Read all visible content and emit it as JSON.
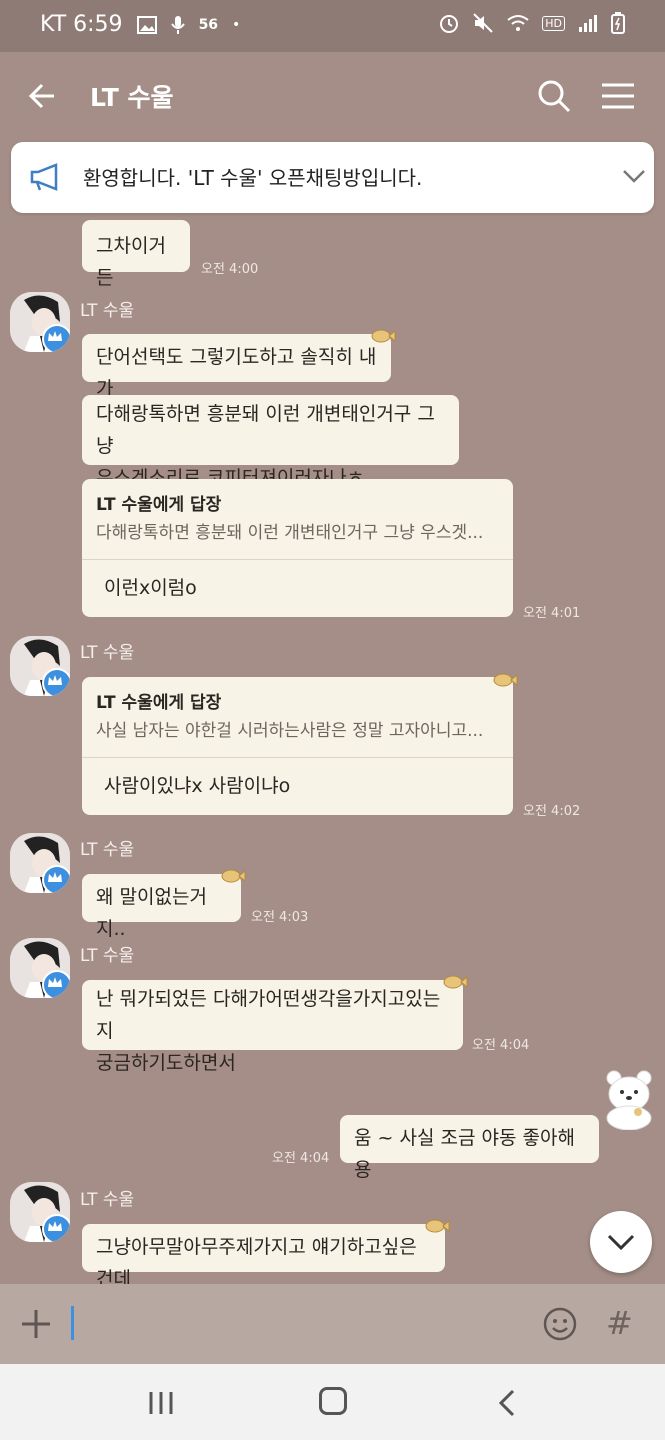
{
  "status": {
    "carrier_time": "KT 6:59",
    "net": "56",
    "dot": "•",
    "hd": "HD",
    "icons": [
      "image-icon",
      "mic-icon",
      "alarm-icon",
      "mute-icon",
      "wifi-icon",
      "signal-icon",
      "battery-icon"
    ]
  },
  "header": {
    "title": "LT 수울"
  },
  "notice": {
    "text": "환영합니다. 'LT 수울' 오픈채팅방입니다."
  },
  "messages": [
    {
      "text": "그차이거든",
      "time": "오전 4:00"
    },
    {
      "sender": "LT 수울",
      "text": "단어선택도 그렇기도하고 솔직히 내가"
    },
    {
      "text_line1": "다해랑톡하면 흥분돼 이런 개변태인거구 그냥",
      "text_line2": "우스겟소리로 코피터져이러자나ㅎ"
    },
    {
      "reply_head": "LT 수울에게 답장",
      "reply_quote": "다해랑톡하면 흥분돼 이런 개변태인거구 그냥 우스겟...",
      "reply_body": "이런x이럼o",
      "time": "오전 4:01"
    },
    {
      "sender": "LT 수울",
      "reply_head": "LT 수울에게 답장",
      "reply_quote": "사실 남자는 야한걸 시러하는사람은 정말 고자아니고...",
      "reply_body": "사람이있냐x 사람이냐o",
      "time": "오전 4:02"
    },
    {
      "sender": "LT 수울",
      "text": "왜 말이없는거지..",
      "time": "오전 4:03"
    },
    {
      "sender": "LT 수울",
      "text_line1": "난 뭐가되었든 다해가어떤생각을가지고있는지",
      "text_line2": "궁금하기도하면서",
      "time": "오전 4:04"
    },
    {
      "text": "움 ~ 사실 조금 야동 좋아해용",
      "time": "오전 4:04"
    },
    {
      "sender": "LT 수울",
      "text": "그냥아무말아무주제가지고 얘기하고싶은건데"
    }
  ],
  "input": {
    "hash": "#"
  },
  "colors": {
    "background": "#a48e87",
    "bubble": "#f7f3e7",
    "accent": "#3d8fe0"
  }
}
